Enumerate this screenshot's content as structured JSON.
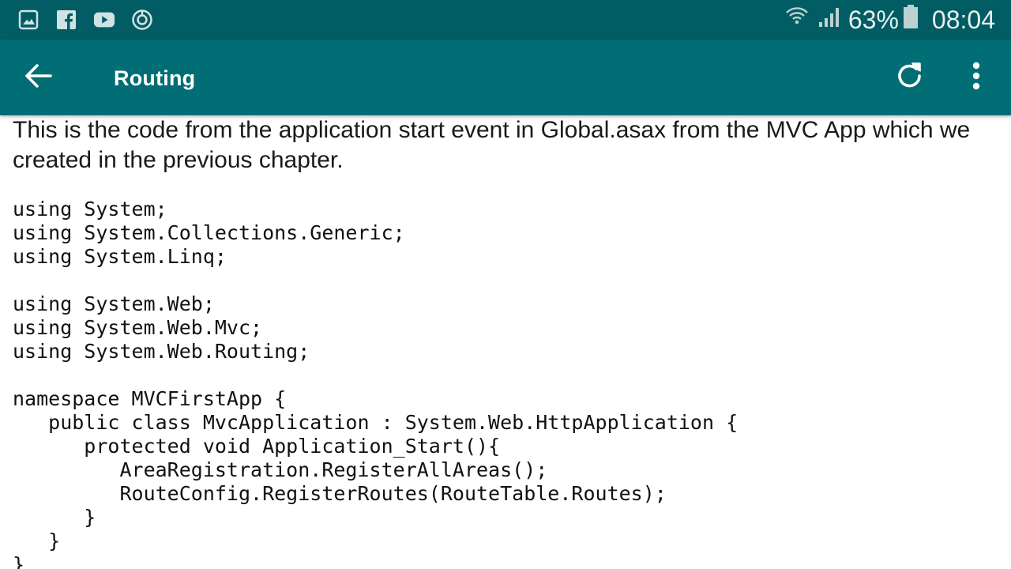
{
  "status_bar": {
    "left_icons": [
      "gallery-icon",
      "facebook-icon",
      "youtube-icon",
      "sync-icon"
    ],
    "battery_percent": "63%",
    "time": "08:04",
    "right_icons": [
      "wifi-icon",
      "signal-icon",
      "battery-icon"
    ]
  },
  "app_bar": {
    "title": "Routing",
    "back_icon": "arrow-left-icon",
    "refresh_icon": "refresh-icon",
    "menu_icon": "more-vert-icon"
  },
  "content": {
    "intro": "This is the code from the application start event in Global.asax from the MVC App which we created in the previous chapter.",
    "code_lines": [
      "using System;",
      "using System.Collections.Generic;",
      "using System.Linq;",
      "",
      "using System.Web;",
      "using System.Web.Mvc;",
      "using System.Web.Routing;",
      "",
      "namespace MVCFirstApp {",
      "   public class MvcApplication : System.Web.HttpApplication {",
      "      protected void Application_Start(){",
      "         AreaRegistration.RegisterAllAreas();",
      "         RouteConfig.RegisterRoutes(RouteTable.Routes);",
      "      }",
      "   }",
      "}"
    ]
  },
  "colors": {
    "status_bar_bg": "#015c63",
    "app_bar_bg": "#006e74",
    "text": "#1a1a1a"
  }
}
